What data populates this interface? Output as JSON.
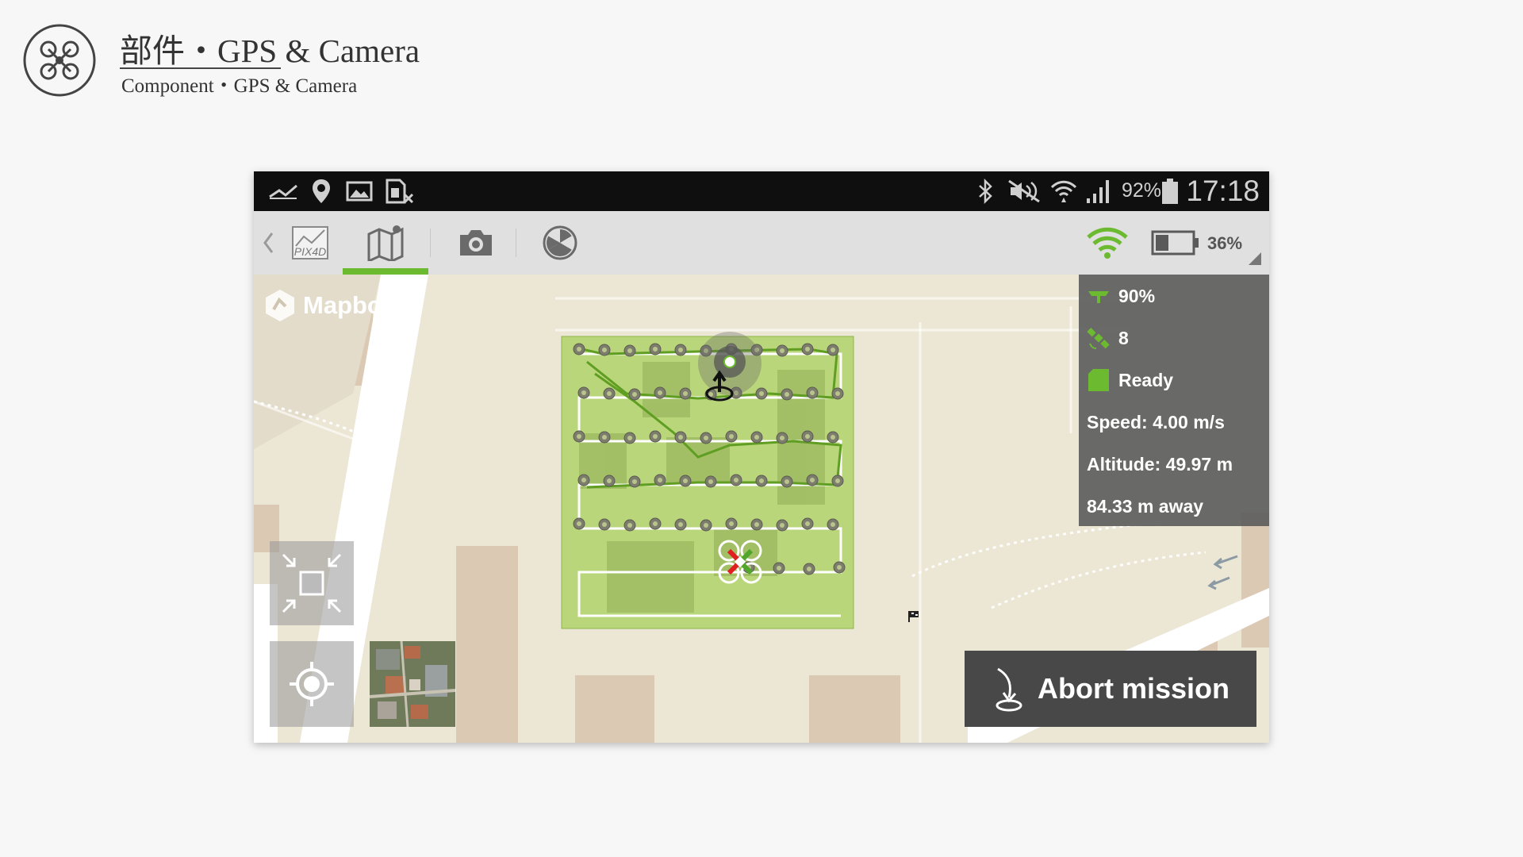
{
  "slide": {
    "title": "部件・GPS & Camera",
    "subtitle": "Component・GPS & Camera"
  },
  "status_bar": {
    "battery_percent": "92%",
    "time": "17:18",
    "left_icons": [
      "missed-call-icon",
      "location-pin-icon",
      "gallery-icon",
      "sim-blocked-icon"
    ],
    "right_icons": [
      "bluetooth-icon",
      "mute-icon",
      "wifi-icon",
      "signal-icon",
      "battery-icon"
    ]
  },
  "toolbar": {
    "back_icon": "chevron-left-icon",
    "logo_text": "PIX4D",
    "tabs": [
      {
        "name": "map-tab",
        "icon": "map-icon",
        "active": true
      },
      {
        "name": "camera-tab",
        "icon": "camera-icon",
        "active": false
      },
      {
        "name": "radiation-tab",
        "icon": "radiation-icon",
        "active": false
      }
    ],
    "wifi_icon": "wifi-icon",
    "battery_level": 0.36,
    "battery_text": "36%",
    "accent_color": "#6cba2f"
  },
  "telemetry": {
    "signal_strength": "90%",
    "satellites": "8",
    "sd_status": "Ready",
    "speed": "Speed: 4.00 m/s",
    "altitude": "Altitude: 49.97 m",
    "distance": "84.33 m away"
  },
  "map": {
    "attribution": "Mapbox",
    "controls": [
      "fit-bounds-icon",
      "locate-icon"
    ],
    "survey_area_color": "#a5cf52"
  },
  "actions": {
    "abort_label": "Abort mission",
    "abort_icon": "landing-icon"
  }
}
